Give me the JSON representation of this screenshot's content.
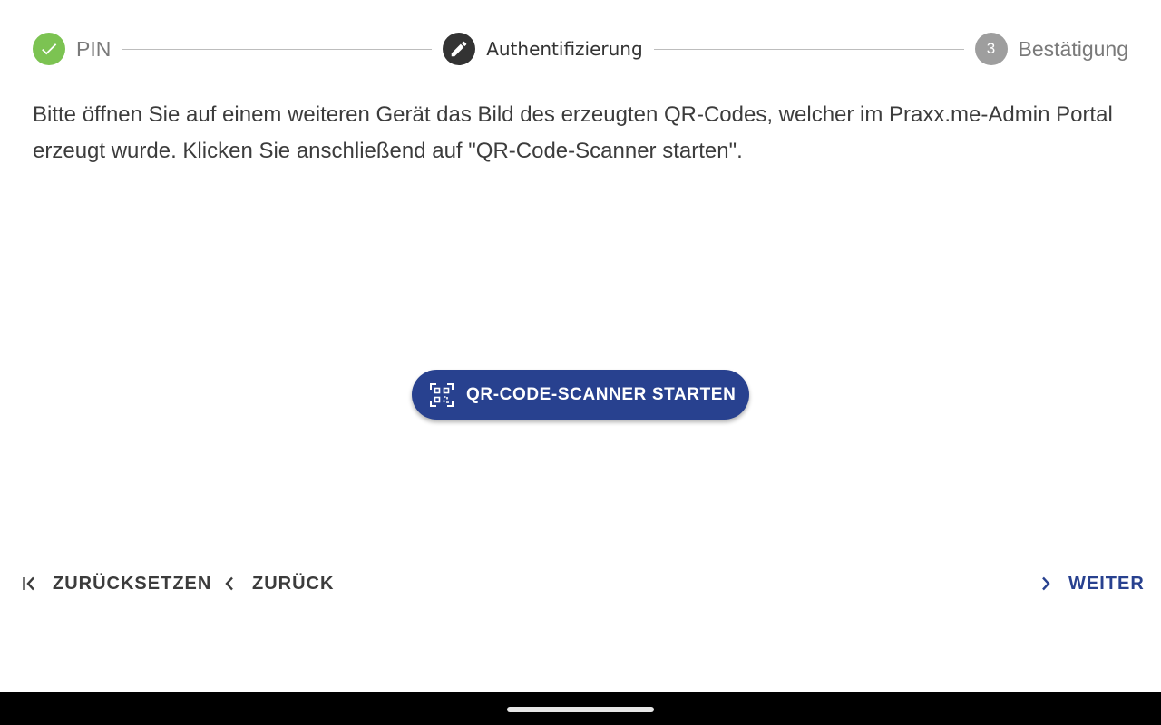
{
  "stepper": {
    "steps": [
      {
        "label": "PIN",
        "status": "done",
        "icon": "check-icon"
      },
      {
        "label": "Authentifizierung",
        "status": "active",
        "icon": "pencil-icon"
      },
      {
        "label": "Bestätigung",
        "status": "pending",
        "number": "3"
      }
    ],
    "colors": {
      "done": "#7cc352",
      "active": "#333333",
      "pending": "#9e9e9e"
    }
  },
  "instruction": {
    "text": "Bitte öffnen Sie auf einem weiteren Gerät das Bild des erzeugten QR-Codes, welcher im Praxx.me-Admin Portal erzeugt wurde. Klicken Sie anschließend auf \"QR-Code-Scanner starten\"."
  },
  "scan_button": {
    "label": "QR-CODE-SCANNER STARTEN",
    "icon": "qr-code-scanner-icon",
    "color": "#28418f"
  },
  "navigation": {
    "reset": {
      "label": "ZURÜCKSETZEN",
      "icon": "first-page-icon"
    },
    "back": {
      "label": "ZURÜCK",
      "icon": "chevron-left-icon"
    },
    "next": {
      "label": "WEITER",
      "icon": "chevron-right-icon",
      "color": "#28418f"
    }
  }
}
